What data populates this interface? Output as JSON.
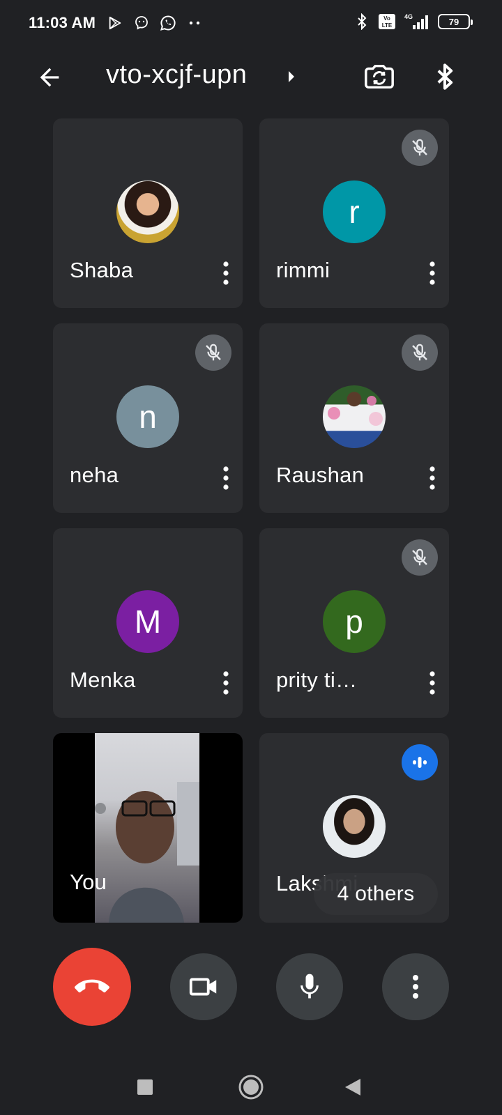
{
  "status_bar": {
    "time": "11:03 AM",
    "left_icons": [
      "play-store-icon",
      "messenger-icon",
      "whatsapp-icon",
      "more-dots-icon"
    ],
    "right_icons": [
      "bluetooth-icon",
      "volte-icon",
      "signal-4g-icon"
    ],
    "battery": "79"
  },
  "header": {
    "meeting_code": "vto-xcjf-upn",
    "icons": [
      "back-arrow-icon",
      "caret-right-icon",
      "switch-camera-icon",
      "bluetooth-audio-icon"
    ]
  },
  "participants": [
    {
      "name": "Shaba",
      "avatar_type": "photo",
      "muted": false
    },
    {
      "name": "rimmi",
      "avatar_type": "letter",
      "initial": "r",
      "color": "#0097a7",
      "muted": true
    },
    {
      "name": "neha",
      "avatar_type": "letter",
      "initial": "n",
      "color": "#78909c",
      "muted": true
    },
    {
      "name": "Raushan",
      "avatar_type": "photo",
      "muted": true
    },
    {
      "name": "Menka",
      "avatar_type": "letter",
      "initial": "M",
      "color": "#7b1fa2",
      "muted": false
    },
    {
      "name": "prity ti…",
      "avatar_type": "letter",
      "initial": "p",
      "color": "#33691e",
      "muted": true
    },
    {
      "name": "You",
      "avatar_type": "video",
      "muted": false
    },
    {
      "name": "Lakshmi",
      "avatar_type": "photo",
      "muted": false,
      "speaking": true
    }
  ],
  "others_pill": "4 others",
  "controls": {
    "end_call_color": "#ea4335",
    "buttons": [
      "end-call-icon",
      "camera-icon",
      "mic-icon",
      "more-vert-icon"
    ]
  },
  "nav": [
    "recents-icon",
    "home-icon",
    "back-icon"
  ]
}
